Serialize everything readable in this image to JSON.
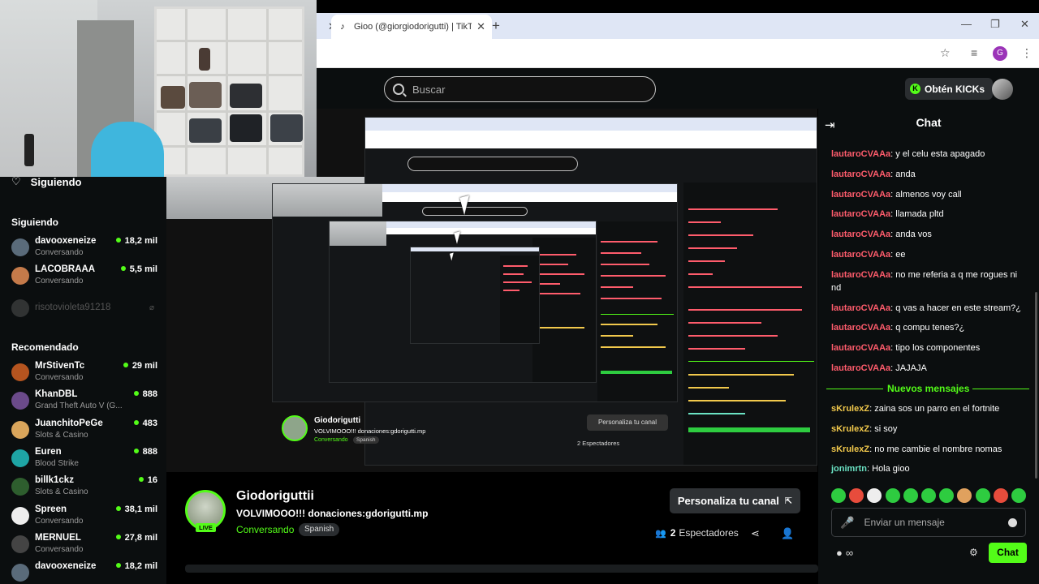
{
  "browser": {
    "tab_active_title": "Gioo (@giorgiodorigutti) | TikTo",
    "tab_close": "✕",
    "new_tab": "+",
    "profile_initial": "G",
    "icons": [
      "tiktok-icon",
      "star-icon",
      "media-icon",
      "profile-icon",
      "menu-icon"
    ]
  },
  "topbar": {
    "search_placeholder": "Buscar",
    "kicks_label": "Obtén KICKs"
  },
  "sidebar": {
    "following_button": "Siguiendo",
    "following_header": "Siguiendo",
    "recommended_header": "Recomendado",
    "following": [
      {
        "name": "davooxeneize",
        "sub": "Conversando",
        "viewers": "18,2 mil",
        "color": "#5a6b7a"
      },
      {
        "name": "LACOBRAAA",
        "sub": "Conversando",
        "viewers": "5,5 mil",
        "color": "#c47a4a"
      }
    ],
    "offline": [
      {
        "name": "risotovioleta91218",
        "color": "#777"
      }
    ],
    "recommended": [
      {
        "name": "MrStivenTc",
        "sub": "Conversando",
        "viewers": "29 mil",
        "color": "#b5541f"
      },
      {
        "name": "KhanDBL",
        "sub": "Grand Theft Auto V (G...",
        "viewers": "888",
        "color": "#6b4a8a"
      },
      {
        "name": "JuanchitoPeGe",
        "sub": "Slots & Casino",
        "viewers": "483",
        "color": "#d9a55b"
      },
      {
        "name": "Euren",
        "sub": "Blood Strike",
        "viewers": "888",
        "color": "#1ea5a5"
      },
      {
        "name": "billk1ckz",
        "sub": "Slots & Casino",
        "viewers": "16",
        "color": "#2e5e2e"
      },
      {
        "name": "Spreen",
        "sub": "Conversando",
        "viewers": "38,1 mil",
        "color": "#eeeeee"
      },
      {
        "name": "MERNUEL",
        "sub": "Conversando",
        "viewers": "27,8 mil",
        "color": "#444444"
      },
      {
        "name": "davooxeneize",
        "sub": "",
        "viewers": "18,2 mil",
        "color": "#5a6b7a"
      }
    ]
  },
  "preview": {
    "inner_channel": "Giodorigutti",
    "inner_title": "VOLVIMOOO!!! donaciones:gdorigutti.mp",
    "inner_category": "Conversando",
    "inner_language": "Spanish",
    "inner_personalize": "Personaliza tu canal",
    "inner_viewers": "2 Espectadores"
  },
  "channel": {
    "name": "Giodoriguttii",
    "title": "VOLVIMOOO!!! donaciones:gdorigutti.mp",
    "category": "Conversando",
    "language": "Spanish",
    "live_badge": "LIVE",
    "personalize": "Personaliza tu canal",
    "viewer_count": "2",
    "viewer_label": "Espectadores"
  },
  "chat": {
    "title": "Chat",
    "new_messages_label": "Nuevos mensajes",
    "messages": [
      {
        "user": "lautaroCVAAa",
        "text": "y el celu esta apagado"
      },
      {
        "user": "lautaroCVAAa",
        "text": "anda"
      },
      {
        "user": "lautaroCVAAa",
        "text": "almenos voy call"
      },
      {
        "user": "lautaroCVAAa",
        "text": "llamada pltd"
      },
      {
        "user": "lautaroCVAAa",
        "text": "anda vos"
      },
      {
        "user": "lautaroCVAAa",
        "text": "ee"
      },
      {
        "user": "lautaroCVAAa",
        "text": "no me referia a q me rogues ni nd"
      },
      {
        "user": "lautaroCVAAa",
        "text": "q vas a hacer en este stream?¿"
      },
      {
        "user": "lautaroCVAAa",
        "text": "q compu tenes?¿"
      },
      {
        "user": "lautaroCVAAa",
        "text": "tipo los componentes"
      },
      {
        "user": "lautaroCVAAa",
        "text": "JAJAJA"
      }
    ],
    "new_messages": [
      {
        "user": "sKrulexZ",
        "text": "zaina sos un parro en el fortnite"
      },
      {
        "user": "sKrulexZ",
        "text": "si soy"
      },
      {
        "user": "sKrulexZ",
        "text": "no me cambie el nombre nomas"
      },
      {
        "user": "jonimrtn",
        "text": "Hola gioo"
      }
    ],
    "input_placeholder": "Enviar un mensaje",
    "send_label": "Chat",
    "colors": {
      "lautaro": "#ff5c6c",
      "skrulex": "#f2c94c",
      "joni": "#6be3c4",
      "accent": "#53fc18"
    }
  }
}
